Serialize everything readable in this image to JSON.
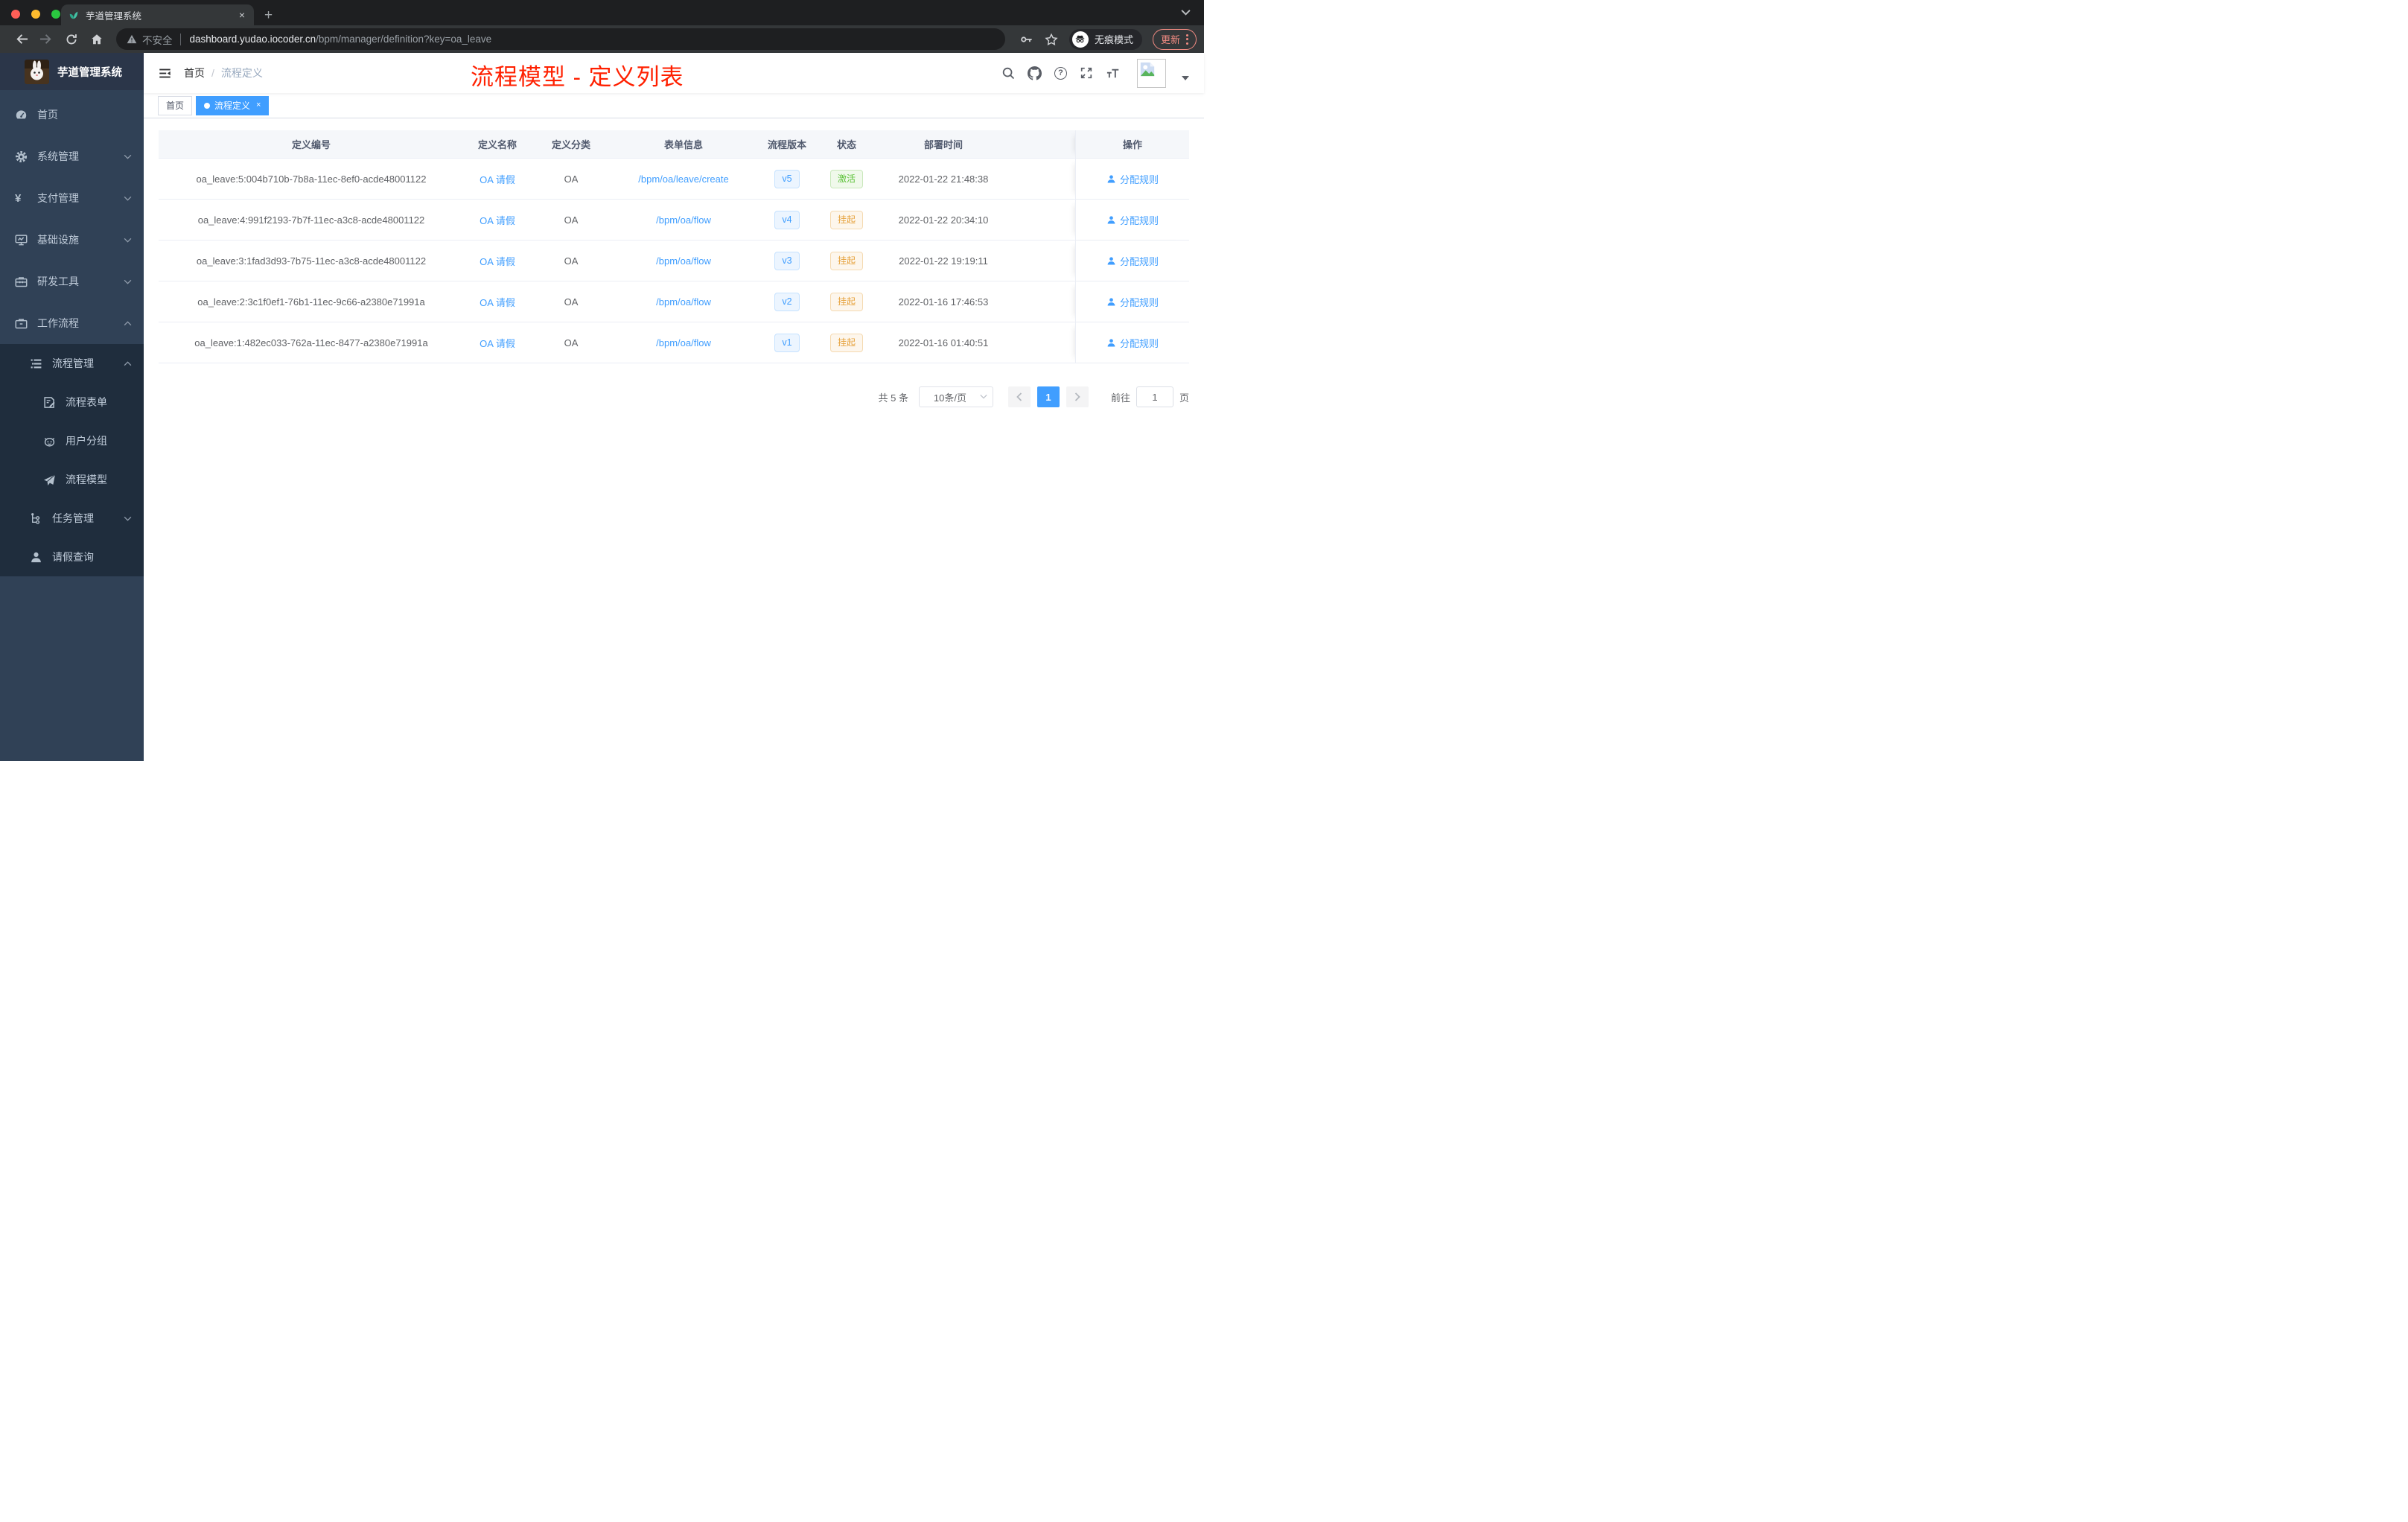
{
  "browser": {
    "tab_title": "芋道管理系统",
    "tab_close": "×",
    "new_tab": "+",
    "security_label": "不安全",
    "url_host": "dashboard.yudao.iocoder.cn",
    "url_path": "/bpm/manager/definition?key=oa_leave",
    "incognito_label": "无痕模式",
    "update_label": "更新"
  },
  "sidebar": {
    "title": "芋道管理系统",
    "menu": [
      {
        "label": "首页"
      },
      {
        "label": "系统管理",
        "expanded": false
      },
      {
        "label": "支付管理",
        "expanded": false
      },
      {
        "label": "基础设施",
        "expanded": false
      },
      {
        "label": "研发工具",
        "expanded": false
      },
      {
        "label": "工作流程",
        "expanded": true
      },
      {
        "label": "流程管理",
        "expanded": true
      },
      {
        "label": "流程表单"
      },
      {
        "label": "用户分组"
      },
      {
        "label": "流程模型"
      },
      {
        "label": "任务管理",
        "expanded": false
      },
      {
        "label": "请假查询"
      }
    ]
  },
  "header": {
    "breadcrumb_root": "首页",
    "breadcrumb_separator": "/",
    "breadcrumb_current": "流程定义",
    "annotation": "流程模型 - 定义列表",
    "annotation_color": "#ff2000"
  },
  "tags_view": {
    "tabs": [
      {
        "label": "首页"
      },
      {
        "label": "流程定义",
        "active": true,
        "close": "×"
      }
    ]
  },
  "table": {
    "columns": [
      "定义编号",
      "定义名称",
      "定义分类",
      "表单信息",
      "流程版本",
      "状态",
      "部署时间",
      "操作"
    ],
    "rows": [
      {
        "id": "oa_leave:5:004b710b-7b8a-11ec-8ef0-acde48001122",
        "name": "OA 请假",
        "category": "OA",
        "form": "/bpm/oa/leave/create",
        "version": "v5",
        "status": "激活",
        "status_type": "success",
        "time": "2022-01-22 21:48:38",
        "action": "分配规则"
      },
      {
        "id": "oa_leave:4:991f2193-7b7f-11ec-a3c8-acde48001122",
        "name": "OA 请假",
        "category": "OA",
        "form": "/bpm/oa/flow",
        "version": "v4",
        "status": "挂起",
        "status_type": "warning",
        "time": "2022-01-22 20:34:10",
        "action": "分配规则"
      },
      {
        "id": "oa_leave:3:1fad3d93-7b75-11ec-a3c8-acde48001122",
        "name": "OA 请假",
        "category": "OA",
        "form": "/bpm/oa/flow",
        "version": "v3",
        "status": "挂起",
        "status_type": "warning",
        "time": "2022-01-22 19:19:11",
        "action": "分配规则"
      },
      {
        "id": "oa_leave:2:3c1f0ef1-76b1-11ec-9c66-a2380e71991a",
        "name": "OA 请假",
        "category": "OA",
        "form": "/bpm/oa/flow",
        "version": "v2",
        "status": "挂起",
        "status_type": "warning",
        "time": "2022-01-16 17:46:53",
        "action": "分配规则"
      },
      {
        "id": "oa_leave:1:482ec033-762a-11ec-8477-a2380e71991a",
        "name": "OA 请假",
        "category": "OA",
        "form": "/bpm/oa/flow",
        "version": "v1",
        "status": "挂起",
        "status_type": "warning",
        "time": "2022-01-16 01:40:51",
        "action": "分配规则"
      }
    ]
  },
  "pagination": {
    "total": "共 5 条",
    "page_size": "10条/页",
    "current_page": "1",
    "goto_label": "前往",
    "goto_value": "1",
    "page_unit": "页"
  },
  "colors": {
    "accent": "#409eff",
    "annotation_red": "#ff2000",
    "status_active_green": "#5dc239",
    "status_suspended_orange": "#e6a23c",
    "sidebar_bg": "#304156",
    "submenu_bg": "#1f2d3d"
  }
}
